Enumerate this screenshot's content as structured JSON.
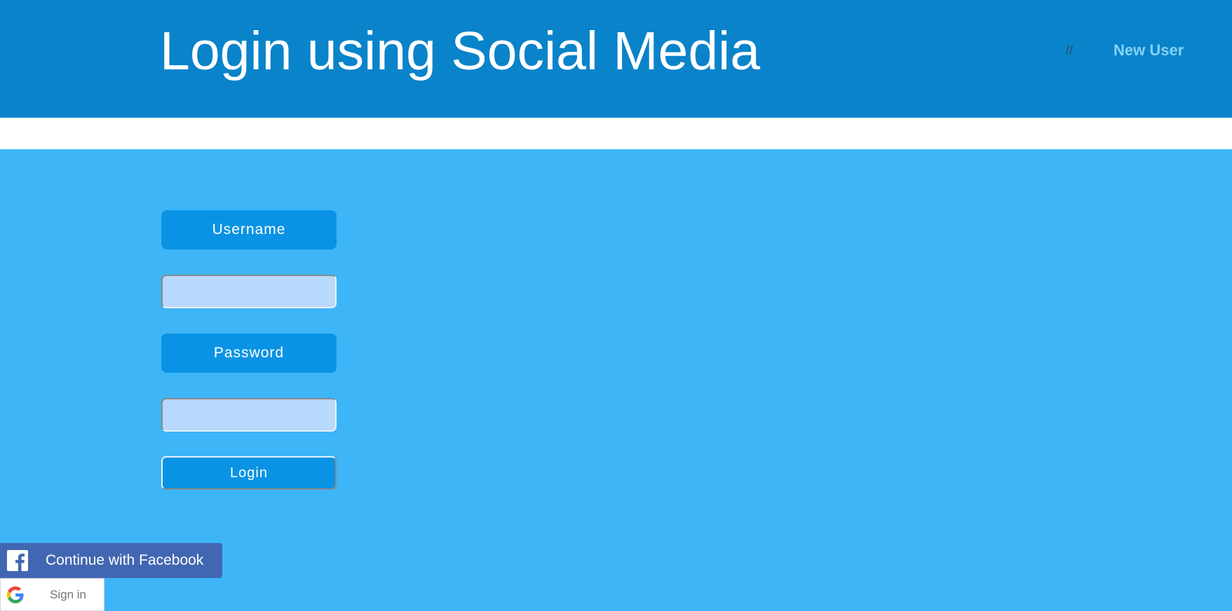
{
  "header": {
    "title": "Login using Social Media",
    "nav_separator": "//",
    "new_user_link": "New User"
  },
  "form": {
    "username_label": "Username",
    "username_value": "",
    "password_label": "Password",
    "password_value": "",
    "login_button": "Login"
  },
  "social": {
    "facebook_label": "Continue with Facebook",
    "google_label": "Sign in"
  },
  "colors": {
    "header_bg": "#0983ca",
    "page_bg": "#3db5f7",
    "label_bg": "#0a93e4",
    "input_bg": "#b8d8fc",
    "facebook_bg": "#4267b2",
    "link_color": "#84d2f6"
  },
  "icons": {
    "facebook": "facebook-icon",
    "google": "google-icon"
  }
}
